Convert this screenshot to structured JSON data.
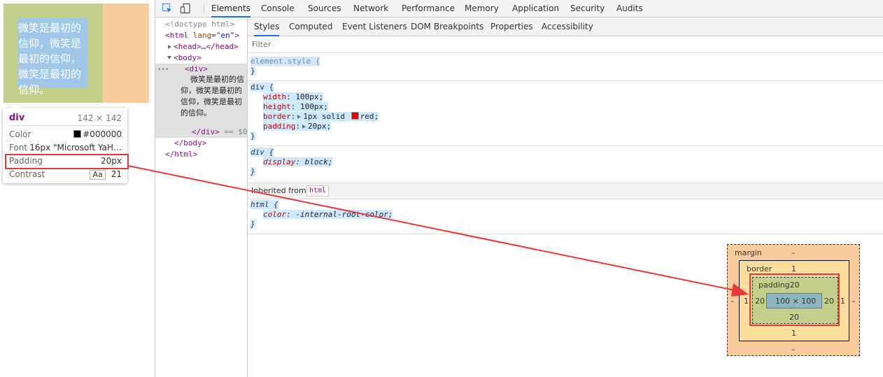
{
  "page": {
    "demo_text": "微笑是最初的信仰，微笑是最初的信仰，微笑是最初的信仰。"
  },
  "tooltip": {
    "tag": "div",
    "size": "142 × 142",
    "rows": [
      {
        "label": "Color",
        "value": "#000000"
      },
      {
        "label": "Font",
        "value": "16px \"Microsoft YaH…"
      },
      {
        "label": "Padding",
        "value": "20px"
      },
      {
        "label": "Contrast",
        "aa": "Aa",
        "value": "21"
      }
    ],
    "color_swatch": "#000000"
  },
  "devtools": {
    "tabs": [
      "Elements",
      "Console",
      "Sources",
      "Network",
      "Performance",
      "Memory",
      "Application",
      "Security",
      "Audits"
    ],
    "active_tab": "Elements",
    "subtabs": [
      "Styles",
      "Computed",
      "Event Listeners",
      "DOM Breakpoints",
      "Properties",
      "Accessibility"
    ],
    "active_subtab": "Styles",
    "filter_placeholder": "Filter",
    "dom": {
      "doctype": "<!doctype html>",
      "html_open_tag": "<html",
      "html_attr_name": "lang",
      "html_attr_value": "\"en\"",
      "head": "<head>…</head>",
      "body_open": "<body>",
      "ellipsis": "•••",
      "div_open": "<div>",
      "div_text": "微笑是最初的信仰，微笑是最初的信仰，微笑是最初的信仰。",
      "div_close": "</div>",
      "div_suffix": " == $0",
      "body_close": "</body>",
      "html_close": "</html>"
    },
    "styles": {
      "element_style_selector": "element.style {",
      "close_brace": "}",
      "rule1_selector": "div {",
      "rule1_props": [
        {
          "name": "width",
          "value": "100px;"
        },
        {
          "name": "height",
          "value": "100px;"
        },
        {
          "name": "border",
          "value_pre": "1px solid",
          "value_post": "red;"
        },
        {
          "name": "padding",
          "value": "20px;"
        }
      ],
      "rule2_selector": "div {",
      "rule2_prop": {
        "name": "display",
        "value": "block;"
      },
      "inherited_label": "Inherited from",
      "inherited_chip": "html",
      "rule3_selector": "html {",
      "rule3_prop": {
        "name": "color",
        "value": "-internal-root-color;"
      },
      "border_color": "#ff0000"
    },
    "box_model": {
      "margin_label": "margin",
      "margin_top": "–",
      "margin_bottom": "–",
      "margin_left": "–",
      "margin_right": "–",
      "border_label": "border",
      "border_top": "1",
      "border_bottom": "1",
      "border_left": "1",
      "border_right": "1",
      "padding_label": "padding20",
      "padding_bottom": "20",
      "padding_left": "20",
      "padding_right": "20",
      "content": "100 × 100"
    }
  },
  "annotation": {
    "color": "#e8393a"
  }
}
